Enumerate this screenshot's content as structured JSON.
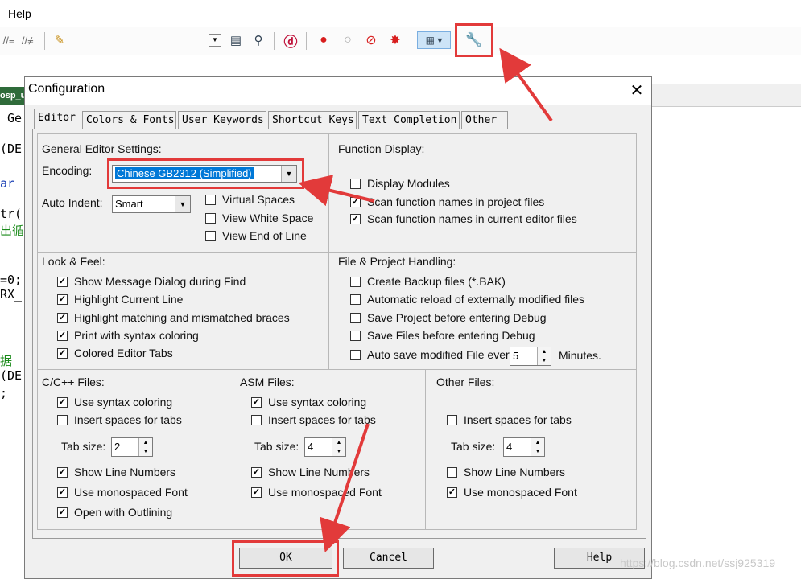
{
  "menu": {
    "help": "Help"
  },
  "background_code": {
    "tab_label": "osp_u",
    "lines": [
      "_Ge",
      "(DE",
      "ar",
      "tr(",
      "出循",
      "=0;",
      "RX_",
      "据",
      "(DE",
      ";"
    ]
  },
  "dialog": {
    "title": "Configuration",
    "close": "✕",
    "tabs": [
      "Editor",
      "Colors & Fonts",
      "User Keywords",
      "Shortcut Keys",
      "Text Completion",
      "Other"
    ],
    "general": {
      "title": "General Editor Settings:",
      "encoding_label": "Encoding:",
      "encoding_value": "Chinese GB2312 (Simplified)",
      "auto_indent_label": "Auto Indent:",
      "auto_indent_value": "Smart",
      "virtual_spaces": "Virtual Spaces",
      "view_white_space": "View White Space",
      "view_end_of_line": "View End of Line"
    },
    "function_display": {
      "title": "Function Display:",
      "display_modules": "Display Modules",
      "scan_project": "Scan function names in project files",
      "scan_current": "Scan function names in current editor files"
    },
    "look_feel": {
      "title": "Look & Feel:",
      "items": [
        "Show Message Dialog during Find",
        "Highlight Current Line",
        "Highlight matching and mismatched braces",
        "Print with syntax coloring",
        "Colored Editor Tabs"
      ]
    },
    "file_project": {
      "title": "File & Project Handling:",
      "items": [
        "Create Backup files (*.BAK)",
        "Automatic reload of externally modified files",
        "Save Project before entering Debug",
        "Save Files before entering Debug",
        "Auto save modified File every"
      ],
      "minutes_value": "5",
      "minutes_label": "Minutes."
    },
    "cpp": {
      "title": "C/C++ Files:",
      "syntax": "Use syntax coloring",
      "spaces": "Insert spaces for tabs",
      "tab_size_label": "Tab size:",
      "tab_size": "2",
      "line_numbers": "Show Line Numbers",
      "monospaced": "Use monospaced Font",
      "outlining": "Open with Outlining"
    },
    "asm": {
      "title": "ASM Files:",
      "syntax": "Use syntax coloring",
      "spaces": "Insert spaces for tabs",
      "tab_size_label": "Tab size:",
      "tab_size": "4",
      "line_numbers": "Show Line Numbers",
      "monospaced": "Use monospaced Font"
    },
    "other": {
      "title": "Other Files:",
      "spaces": "Insert spaces for tabs",
      "tab_size_label": "Tab size:",
      "tab_size": "4",
      "line_numbers": "Show Line Numbers",
      "monospaced": "Use monospaced Font"
    },
    "buttons": {
      "ok": "OK",
      "cancel": "Cancel",
      "help": "Help"
    },
    "check_mark": "✓"
  },
  "watermark": "https://blog.csdn.net/ssj925319",
  "colors": {
    "annotation": "#e23a3a",
    "selection": "#0078d7",
    "code_blue": "#1a3fb5",
    "code_green": "#1a8a1a"
  }
}
